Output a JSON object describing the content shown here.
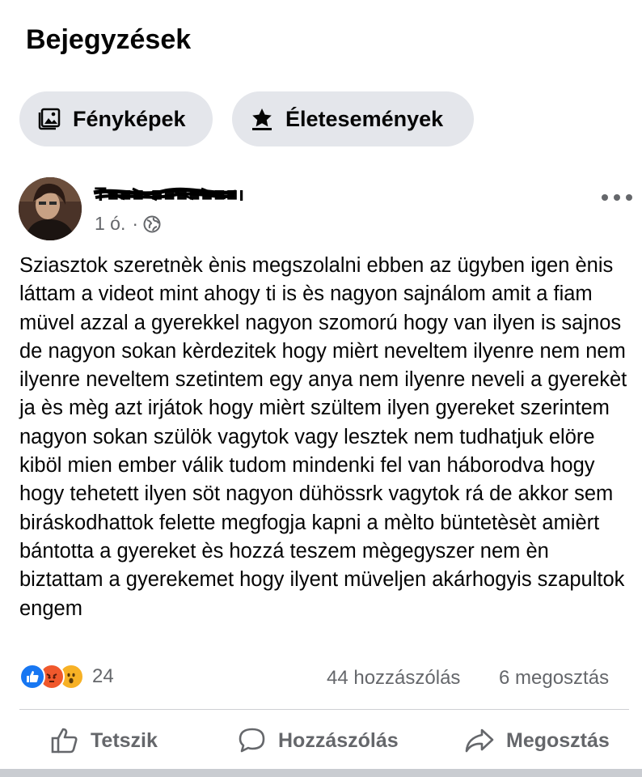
{
  "section": {
    "title": "Bejegyzések"
  },
  "filters": [
    {
      "label": "Fényképek",
      "icon": "photos-icon"
    },
    {
      "label": "Életesemények",
      "icon": "life-event-icon"
    }
  ],
  "post": {
    "author": "T■■■ ■■■■■■■ı",
    "time": "1 ó.",
    "separator": "·",
    "audience_icon": "globe-icon",
    "text": "Sziasztok szeretnèk ènis megszolalni ebben az ügyben igen ènis láttam a videot mint ahogy ti is ès nagyon sajnálom amit a fiam müvel azzal a gyerekkel nagyon szomorú hogy van ilyen is sajnos de nagyon sokan kèrdezitek hogy mièrt neveltem ilyenre nem nem ilyenre neveltem szetintem egy anya nem ilyenre neveli a gyerekèt ja ès mèg azt irjátok hogy mièrt szültem ilyen gyereket szerintem nagyon sokan szülök vagytok vagy lesztek nem tudhatjuk elöre kiböl mien ember válik tudom mindenki fel van háborodva hogy hogy tehetett ilyen söt nagyon dühössrk vagytok rá de akkor sem biráskodhattok felette megfogja kapni a mèlto büntetèsèt amièrt bántotta a gyereket ès hozzá teszem mègegyszer nem èn biztattam a gyerekemet hogy ilyent müveljen akárhogyis szapultok engem",
    "reactions": {
      "types": [
        "like",
        "angry",
        "wow"
      ],
      "count": "24"
    },
    "comments": "44 hozzászólás",
    "shares": "6 megosztás"
  },
  "actions": {
    "like": "Tetszik",
    "comment": "Hozzászólás",
    "share": "Megosztás"
  },
  "colors": {
    "pill_bg": "#e4e6eb",
    "secondary_text": "#65676b",
    "like_blue": "#1877f2",
    "angry_orange": "#f0582c",
    "wow_yellow": "#f7b125"
  }
}
